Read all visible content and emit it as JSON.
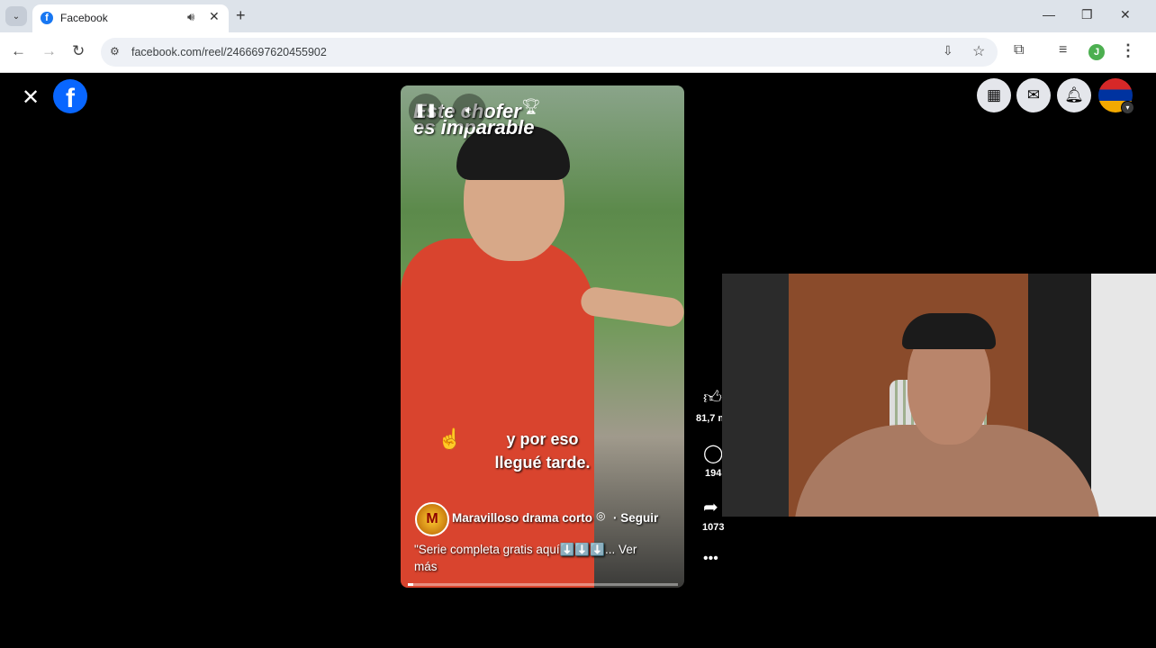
{
  "browser": {
    "tab_title": "Facebook",
    "tab_audio_icon": "speaker-icon",
    "url": "facebook.com/reel/2466697620455902"
  },
  "reel": {
    "overlay_title": "Este chofer\nes imparable",
    "subtitle_line1": "y por eso",
    "subtitle_line2": "llegué tarde.",
    "page_name": "Maravilloso drama corto",
    "page_avatar_letter": "M",
    "follow_label": "· Seguir",
    "caption": "\"Serie completa gratis aquí⬇️⬇️⬇️... Ver más",
    "progress": 0.02
  },
  "actions": {
    "likes": "81,7 m",
    "comments": "194",
    "shares": "1073"
  },
  "colors": {
    "facebook_blue": "#0866ff",
    "chrome_tabbar": "#dde3ea"
  }
}
